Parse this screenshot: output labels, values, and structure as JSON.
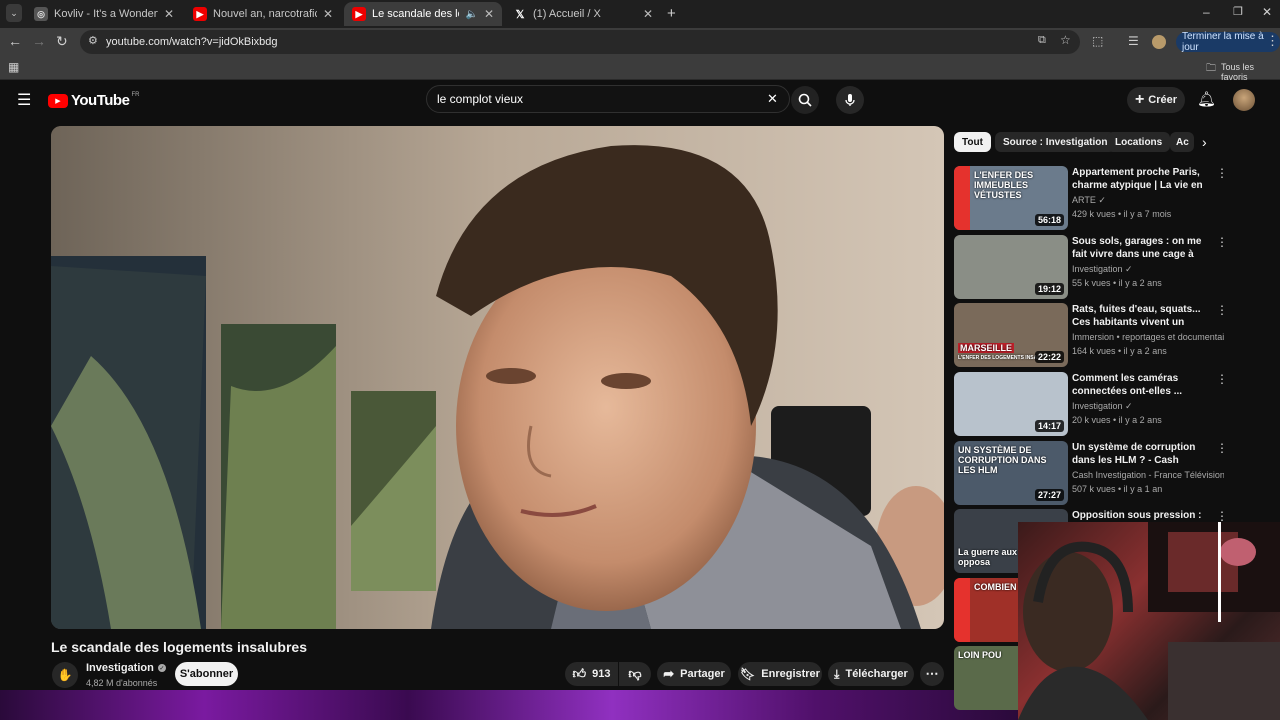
{
  "browser": {
    "tabs": [
      {
        "title": "Kovliv - It's a Wonderful Knife (",
        "favicon": "globe-icon"
      },
      {
        "title": "Nouvel an, narcotrafic...L'interv",
        "favicon": "youtube-icon"
      },
      {
        "title": "Le scandale des logements",
        "favicon": "youtube-icon"
      },
      {
        "title": "(1) Accueil / X",
        "favicon": "x-icon"
      }
    ],
    "url": "youtube.com/watch?v=jidOkBixbdg",
    "update_button": "Terminer la mise à jour",
    "all_bookmarks": "Tous les favoris"
  },
  "youtube": {
    "logo_text": "YouTube",
    "logo_region": "FR",
    "search_value": "le complot vieux",
    "create_label": "Créer"
  },
  "video": {
    "title": "Le scandale des logements insalubres",
    "channel": "Investigation",
    "subscribers": "4,82 M d'abonnés",
    "subscribe_label": "S'abonner",
    "likes": "913",
    "share_label": "Partager",
    "save_label": "Enregistrer",
    "download_label": "Télécharger"
  },
  "chips": [
    "Tout",
    "Source : Investigation",
    "Locations",
    "Ac"
  ],
  "recommendations": [
    {
      "title": "Appartement proche Paris, charme atypique | La vie en fa...",
      "channel": "ARTE",
      "verified": true,
      "meta": "429 k vues • il y a 7 mois",
      "duration": "56:18",
      "overlay": "L'ENFER DES IMMEUBLES VÉTUSTES",
      "thumb_color": "#6b7b8c"
    },
    {
      "title": "Sous sols, garages : on me fait vivre dans une cage à lapins",
      "channel": "Investigation",
      "verified": true,
      "meta": "55 k vues • il y a 2 ans",
      "duration": "19:12",
      "overlay": "",
      "thumb_color": "#8a8e86"
    },
    {
      "title": "Rats, fuites d'eau, squats... Ces habitants vivent un calvaire !",
      "channel": "Immersion • reportages et documentair...",
      "verified": false,
      "meta": "164 k vues • il y a 2 ans",
      "duration": "22:22",
      "overlay": "MARSEILLE",
      "overlay2": "L'ENFER DES LOGEMENTS INSAL",
      "thumb_color": "#7a6a5a"
    },
    {
      "title": "Comment les caméras connectées ont-elles ...",
      "channel": "Investigation",
      "verified": true,
      "meta": "20 k vues • il y a 2 ans",
      "duration": "14:17",
      "overlay": "",
      "thumb_color": "#b8c2cc"
    },
    {
      "title": "Un système de corruption dans les HLM ? - Cash investigation",
      "channel": "Cash Investigation - France Télévisions",
      "verified": true,
      "meta": "507 k vues • il y a 1 an",
      "duration": "27:27",
      "overlay": "UN SYSTÈME DE CORRUPTION DANS LES HLM",
      "thumb_color": "#4c5a6a"
    },
    {
      "title": "Opposition sous pression :",
      "channel": "",
      "verified": false,
      "meta": "",
      "duration": "",
      "overlay": "La guerre aux opposa",
      "thumb_color": "#3a4048"
    },
    {
      "title": "",
      "channel": "",
      "verified": false,
      "meta": "",
      "duration": "",
      "overlay": "COMBIEN TRAVAIL",
      "thumb_color": "#a03028"
    },
    {
      "title": "",
      "channel": "",
      "verified": false,
      "meta": "",
      "duration": "",
      "overlay": "LOIN POU",
      "thumb_color": "#5a6a4a"
    }
  ]
}
